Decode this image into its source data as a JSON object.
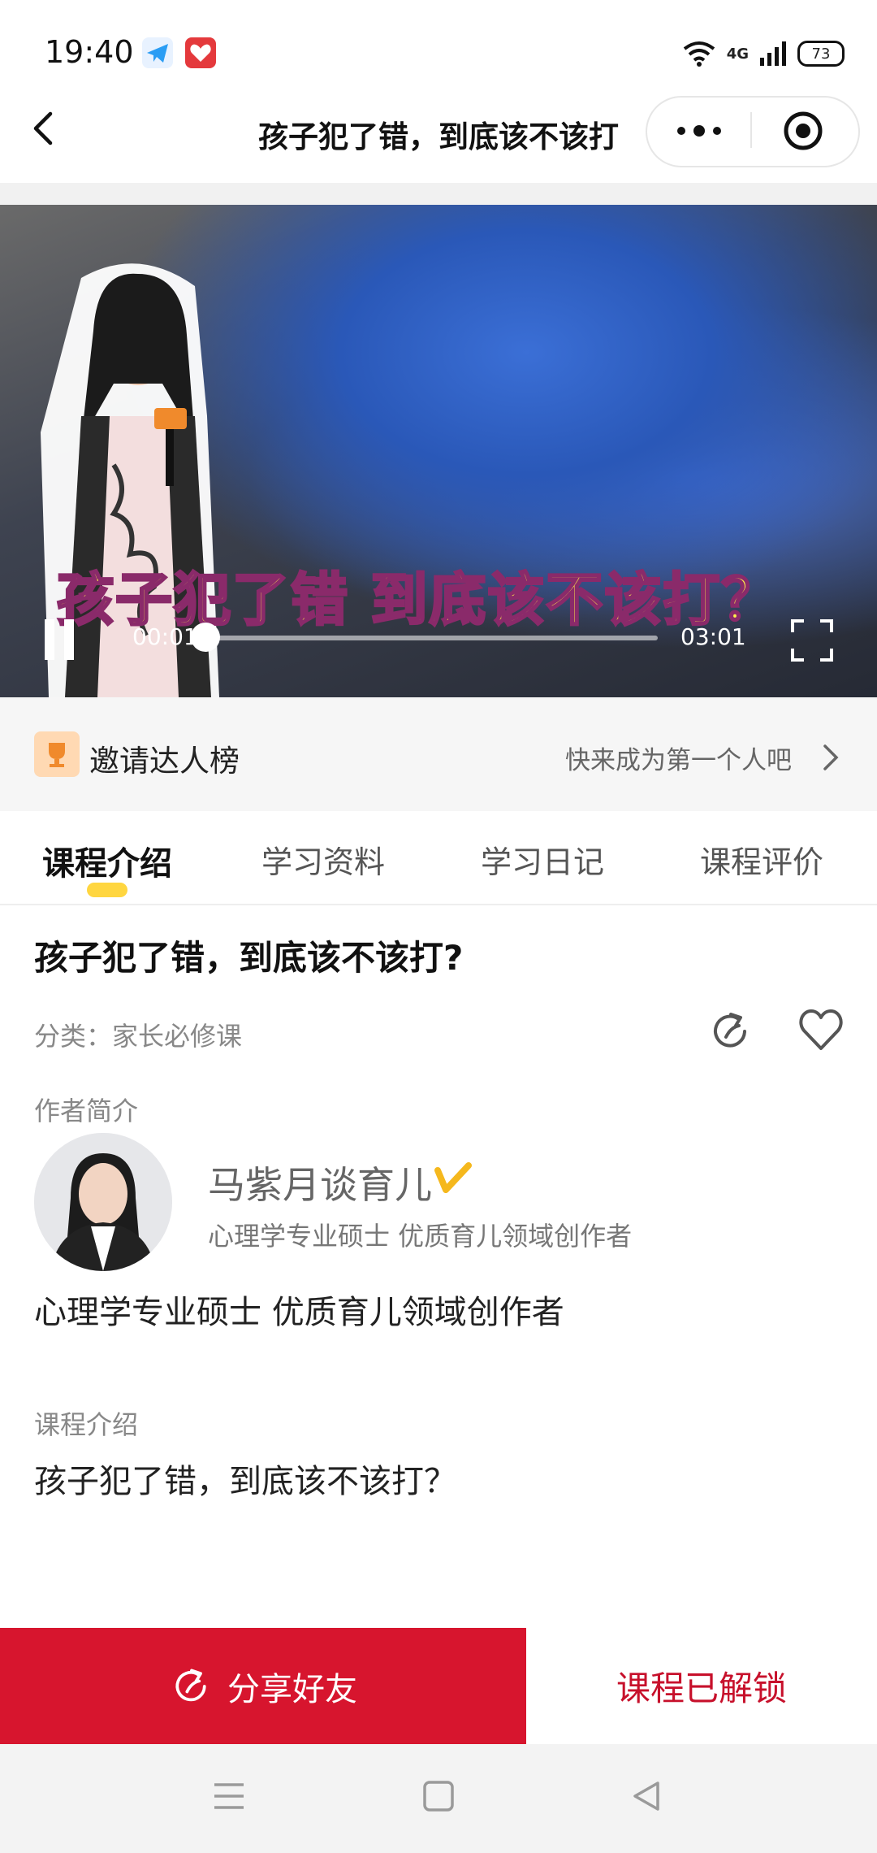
{
  "status_bar": {
    "time": "19:40",
    "network": "4G",
    "battery": "73"
  },
  "nav": {
    "title": "孩子犯了错，到底该不该打"
  },
  "video": {
    "caption": "孩子犯了错 到底该不该打？",
    "current_time": "00:01",
    "total_time": "03:01",
    "progress": 0.005
  },
  "invite": {
    "label": "邀请达人榜",
    "cta": "快来成为第一个人吧"
  },
  "tabs": [
    {
      "label": "课程介绍",
      "active": true
    },
    {
      "label": "学习资料",
      "active": false
    },
    {
      "label": "学习日记",
      "active": false
    },
    {
      "label": "课程评价",
      "active": false
    }
  ],
  "course": {
    "title": "孩子犯了错，到底该不该打?",
    "category": "分类：家长必修课"
  },
  "author": {
    "heading": "作者简介",
    "name": "马紫月谈育儿",
    "subtitle": "心理学专业硕士 优质育儿领域创作者",
    "bio": "心理学专业硕士 优质育儿领域创作者"
  },
  "intro": {
    "heading": "课程介绍",
    "text": "孩子犯了错，到底该不该打？"
  },
  "actions": {
    "share_label": "分享好友",
    "unlocked_label": "课程已解锁"
  },
  "colors": {
    "accent_red": "#d7152e",
    "tab_indicator": "#ffd640",
    "caption_yellow": "#fff04a"
  }
}
